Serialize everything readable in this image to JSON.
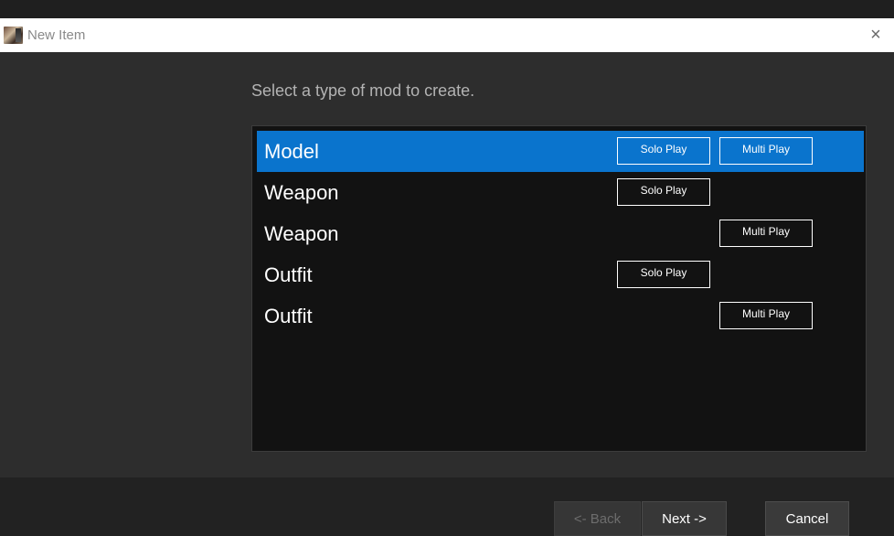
{
  "window": {
    "title": "New Item",
    "close_icon": "×"
  },
  "dialog": {
    "prompt": "Select a type of mod to create."
  },
  "mod_types": [
    {
      "label": "Model",
      "selected": true,
      "solo": "Solo Play",
      "multi": "Multi Play"
    },
    {
      "label": "Weapon",
      "selected": false,
      "solo": "Solo Play",
      "multi": null
    },
    {
      "label": "Weapon",
      "selected": false,
      "solo": null,
      "multi": "Multi Play"
    },
    {
      "label": "Outfit",
      "selected": false,
      "solo": "Solo Play",
      "multi": null
    },
    {
      "label": "Outfit",
      "selected": false,
      "solo": null,
      "multi": "Multi Play"
    }
  ],
  "footer": {
    "back_label": "<- Back",
    "next_label": "Next ->",
    "cancel_label": "Cancel"
  },
  "colors": {
    "selection": "#0a74cd",
    "list_background": "#121212",
    "panel_background": "#2d2d2d"
  }
}
